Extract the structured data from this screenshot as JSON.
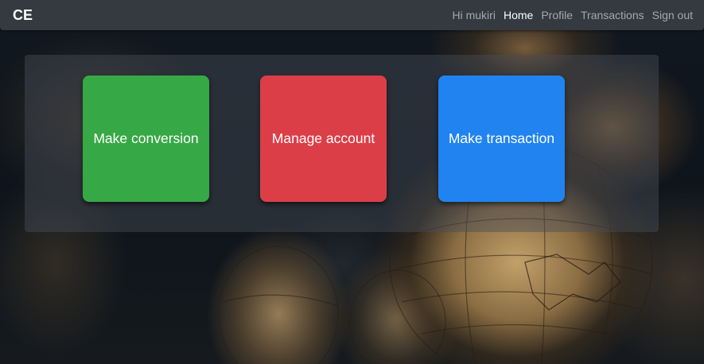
{
  "navbar": {
    "brand": "CE",
    "greeting": "Hi mukiri",
    "links": [
      {
        "label": "Home",
        "active": true
      },
      {
        "label": "Profile",
        "active": false
      },
      {
        "label": "Transactions",
        "active": false
      },
      {
        "label": "Sign out",
        "active": false
      }
    ]
  },
  "actions": [
    {
      "label": "Make conversion",
      "color": "#37a846"
    },
    {
      "label": "Manage account",
      "color": "#dc3e48"
    },
    {
      "label": "Make transaction",
      "color": "#2183f0"
    }
  ],
  "colors": {
    "navbar_bg": "#343a40",
    "panel_bg": "rgba(70,78,88,0.45)"
  }
}
